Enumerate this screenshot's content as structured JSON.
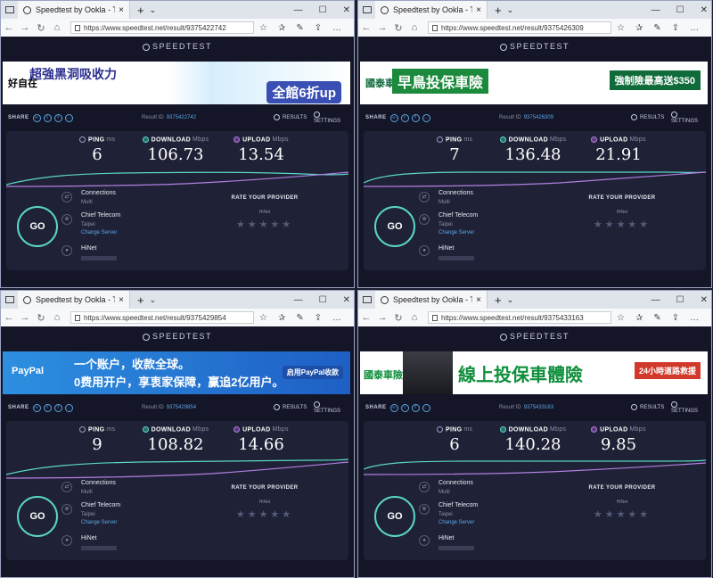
{
  "windows": [
    {
      "tab_title": "Speedtest by Ookla - Th",
      "url": "https://www.speedtest.net/result/9375422742",
      "brand": "SPEEDTEST",
      "ad": {
        "brand": "好自在",
        "main": "超強黑洞吸收力",
        "sub": "全館6折up",
        "line2": ""
      },
      "share_label": "SHARE",
      "result_label": "Result ID",
      "result_id": "9375422742",
      "results_label": "RESULTS",
      "settings_label": "SETTINGS",
      "ping": {
        "label": "PING",
        "unit": "ms",
        "value": "6"
      },
      "download": {
        "label": "DOWNLOAD",
        "unit": "Mbps",
        "value": "106.73"
      },
      "upload": {
        "label": "UPLOAD",
        "unit": "Mbps",
        "value": "13.54"
      },
      "go": "GO",
      "connections": {
        "label": "Connections",
        "value": "Multi"
      },
      "server": {
        "name": "Chief Telecom",
        "city": "Taipei",
        "change": "Change Server"
      },
      "isp": {
        "name": "HiNet"
      },
      "rate": {
        "title": "RATE YOUR PROVIDER",
        "provider": "HiNet",
        "stars": "★★★★★"
      }
    },
    {
      "tab_title": "Speedtest by Ookla - Th",
      "url": "https://www.speedtest.net/result/9375426309",
      "brand": "SPEEDTEST",
      "ad": {
        "brand": "國泰車險",
        "main": "早鳥投保車險",
        "sub": "強制險最高送$350",
        "line2": ""
      },
      "share_label": "SHARE",
      "result_label": "Result ID",
      "result_id": "9375426309",
      "results_label": "RESULTS",
      "settings_label": "SETTINGS",
      "ping": {
        "label": "PING",
        "unit": "ms",
        "value": "7"
      },
      "download": {
        "label": "DOWNLOAD",
        "unit": "Mbps",
        "value": "136.48"
      },
      "upload": {
        "label": "UPLOAD",
        "unit": "Mbps",
        "value": "21.91"
      },
      "go": "GO",
      "connections": {
        "label": "Connections",
        "value": "Multi"
      },
      "server": {
        "name": "Chief Telecom",
        "city": "Taipei",
        "change": "Change Server"
      },
      "isp": {
        "name": "HiNet"
      },
      "rate": {
        "title": "RATE YOUR PROVIDER",
        "provider": "HiNet",
        "stars": "★★★★★"
      }
    },
    {
      "tab_title": "Speedtest by Ookla - Th",
      "url": "https://www.speedtest.net/result/9375429854",
      "brand": "SPEEDTEST",
      "ad": {
        "brand": "PayPal",
        "main": "一个账户，收款全球。",
        "sub": "启用PayPal收款",
        "line2": "0费用开户，享衷家保障，赢追2亿用户。"
      },
      "share_label": "SHARE",
      "result_label": "Result ID",
      "result_id": "9375429854",
      "results_label": "RESULTS",
      "settings_label": "SETTINGS",
      "ping": {
        "label": "PING",
        "unit": "ms",
        "value": "9"
      },
      "download": {
        "label": "DOWNLOAD",
        "unit": "Mbps",
        "value": "108.82"
      },
      "upload": {
        "label": "UPLOAD",
        "unit": "Mbps",
        "value": "14.66"
      },
      "go": "GO",
      "connections": {
        "label": "Connections",
        "value": "Multi"
      },
      "server": {
        "name": "Chief Telecom",
        "city": "Taipei",
        "change": "Change Server"
      },
      "isp": {
        "name": "HiNet"
      },
      "rate": {
        "title": "RATE YOUR PROVIDER",
        "provider": "HiNet",
        "stars": "★★★★★"
      }
    },
    {
      "tab_title": "Speedtest by Ookla - Th",
      "url": "https://www.speedtest.net/result/9375433163",
      "brand": "SPEEDTEST",
      "ad": {
        "brand": "國泰車險",
        "main": "線上投保車體險",
        "sub": "24小時道路救援",
        "line2": ""
      },
      "share_label": "SHARE",
      "result_label": "Result ID",
      "result_id": "9375433163",
      "results_label": "RESULTS",
      "settings_label": "SETTINGS",
      "ping": {
        "label": "PING",
        "unit": "ms",
        "value": "6"
      },
      "download": {
        "label": "DOWNLOAD",
        "unit": "Mbps",
        "value": "140.28"
      },
      "upload": {
        "label": "UPLOAD",
        "unit": "Mbps",
        "value": "9.85"
      },
      "go": "GO",
      "connections": {
        "label": "Connections",
        "value": "Multi"
      },
      "server": {
        "name": "Chief Telecom",
        "city": "Taipei",
        "change": "Change Server"
      },
      "isp": {
        "name": "HiNet"
      },
      "rate": {
        "title": "RATE YOUR PROVIDER",
        "provider": "HiNet",
        "stars": "★★★★★"
      }
    }
  ],
  "colors": {
    "accent": "#5ad6c8",
    "upload": "#b27fe0",
    "link": "#5aa8e8",
    "background": "#141526",
    "panel": "#1f2236"
  },
  "icons": {
    "tab": "globe-icon",
    "back": "arrow-left-icon",
    "forward": "arrow-right-icon",
    "refresh": "refresh-icon",
    "home": "home-icon",
    "lock": "lock-icon",
    "favorite": "star-icon",
    "hub": "list-icon",
    "share": "share-icon"
  }
}
